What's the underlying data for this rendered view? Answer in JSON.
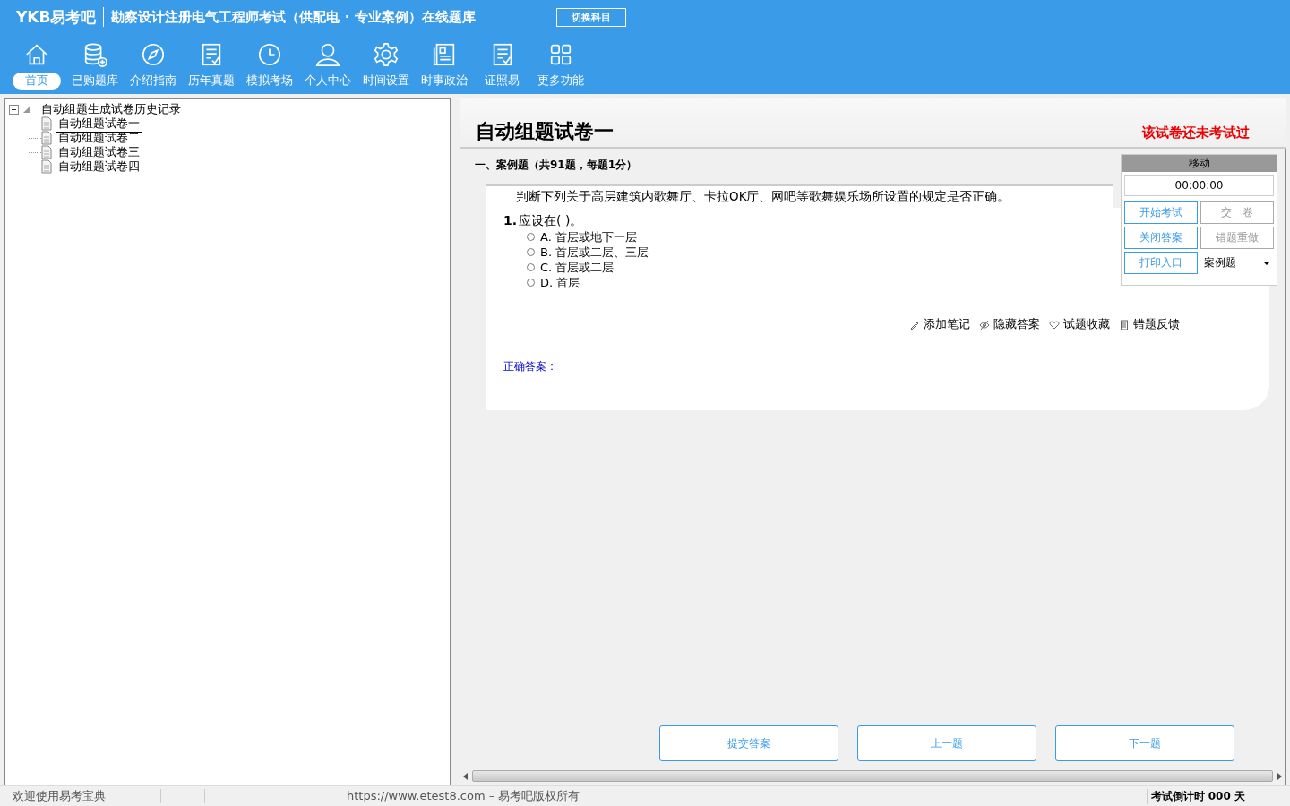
{
  "header": {
    "logo": "YKB易考吧",
    "title": "勘察设计注册电气工程师考试（供配电 · 专业案例）在线题库",
    "switch_button": "切换科目"
  },
  "nav": [
    {
      "label": "首页",
      "selected": true
    },
    {
      "label": "已购题库",
      "selected": false
    },
    {
      "label": "介绍指南",
      "selected": false
    },
    {
      "label": "历年真题",
      "selected": false
    },
    {
      "label": "模拟考场",
      "selected": false
    },
    {
      "label": "个人中心",
      "selected": false
    },
    {
      "label": "时间设置",
      "selected": false
    },
    {
      "label": "时事政治",
      "selected": false
    },
    {
      "label": "证照易",
      "selected": false
    },
    {
      "label": "更多功能",
      "selected": false
    }
  ],
  "tree": {
    "label": "自动组题生成试卷历史记录",
    "children": [
      {
        "label": "自动组题试卷一",
        "selected": true
      },
      {
        "label": "自动组题试卷二",
        "selected": false
      },
      {
        "label": "自动组题试卷三",
        "selected": false
      },
      {
        "label": "自动组题试卷四",
        "selected": false
      }
    ]
  },
  "paper": {
    "title": "自动组题试卷一",
    "status": "该试卷还未考试过"
  },
  "section": "一、案例题（共91题，每题1分）",
  "question": {
    "stem": "判断下列关于高层建筑内歌舞厅、卡拉OK厅、网吧等歌舞娱乐场所设置的规定是否正确。",
    "number": "1.",
    "text": "应设在(  )。",
    "options": [
      {
        "label": "A. 首层或地下一层",
        "selected": false
      },
      {
        "label": "B. 首层或二层、三层",
        "selected": false
      },
      {
        "label": "C. 首层或二层",
        "selected": false
      },
      {
        "label": "D. 首层",
        "selected": false
      }
    ],
    "tools": [
      "添加笔记",
      "隐藏答案",
      "试题收藏",
      "错题反馈"
    ],
    "answer_label": "正确答案："
  },
  "control_panel": {
    "title": "移动",
    "timer": "00:00:00",
    "buttons": [
      {
        "label": "开始考试",
        "kind": "primary"
      },
      {
        "label": "交　卷",
        "kind": "plain"
      },
      {
        "label": "关闭答案",
        "kind": "primary"
      },
      {
        "label": "错题重做",
        "kind": "plain"
      },
      {
        "label": "打印入口",
        "kind": "primary"
      },
      {
        "label": "案例题",
        "kind": "select"
      }
    ]
  },
  "bottom_buttons": [
    "提交答案",
    "上一题",
    "下一题"
  ],
  "status_bar": {
    "welcome": "欢迎使用易考宝典",
    "copyright": "https://www.etest8.com – 易考吧版权所有",
    "countdown": "考试倒计时 000 天"
  }
}
